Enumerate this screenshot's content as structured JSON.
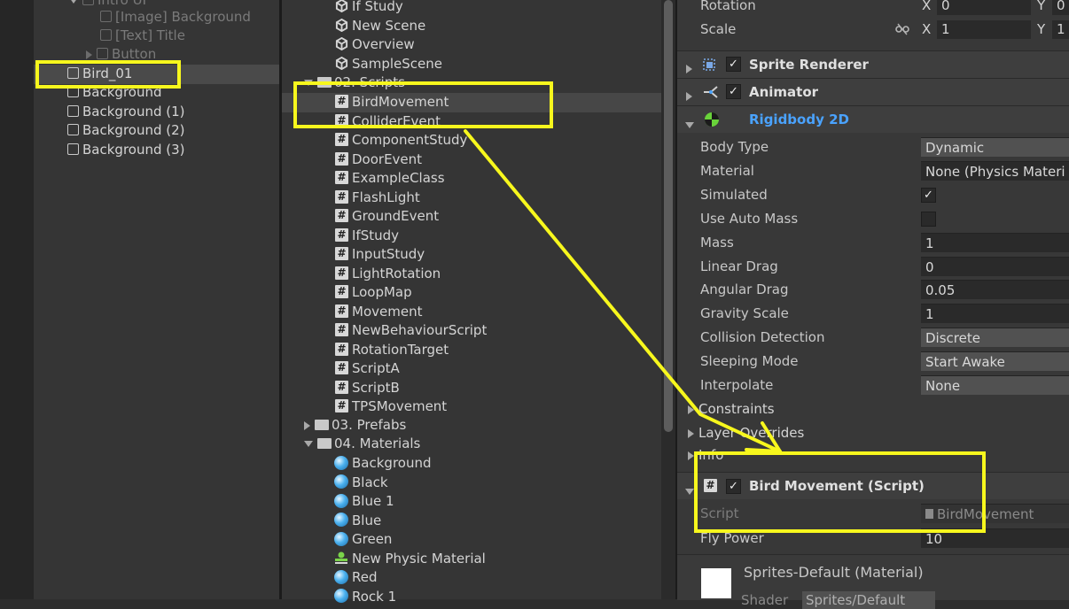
{
  "hierarchy": {
    "partial_top": "Intro UI",
    "items": [
      {
        "label": "[Image] Background",
        "dim": true
      },
      {
        "label": "[Text] Title",
        "dim": true
      },
      {
        "label": "Button",
        "dim": true
      },
      {
        "label": "Bird_01",
        "dim": false
      },
      {
        "label": "Background",
        "dim": false
      },
      {
        "label": "Background (1)",
        "dim": false
      },
      {
        "label": "Background (2)",
        "dim": false
      },
      {
        "label": "Background (3)",
        "dim": false
      }
    ]
  },
  "project": {
    "scenes": [
      "If Study",
      "New Scene",
      "Overview",
      "SampleScene"
    ],
    "scripts_folder": "02. Scripts",
    "scripts": [
      "BirdMovement",
      "ColliderEvent",
      "ComponentStudy",
      "DoorEvent",
      "ExampleClass",
      "FlashLight",
      "GroundEvent",
      "IfStudy",
      "InputStudy",
      "LightRotation",
      "LoopMap",
      "Movement",
      "NewBehaviourScript",
      "RotationTarget",
      "ScriptA",
      "ScriptB",
      "TPSMovement"
    ],
    "prefabs_folder": "03. Prefabs",
    "materials_folder": "04. Materials",
    "materials": [
      {
        "label": "Background",
        "kind": "material"
      },
      {
        "label": "Black",
        "kind": "material"
      },
      {
        "label": "Blue 1",
        "kind": "material"
      },
      {
        "label": "Blue",
        "kind": "material"
      },
      {
        "label": "Green",
        "kind": "material"
      },
      {
        "label": "New Physic Material",
        "kind": "physic"
      },
      {
        "label": "Red",
        "kind": "material"
      },
      {
        "label": "Rock 1",
        "kind": "material"
      }
    ]
  },
  "inspector": {
    "rotation": {
      "label": "Rotation",
      "x_label": "X",
      "x_value": "0",
      "y_label": "Y",
      "y_value": "0"
    },
    "scale": {
      "label": "Scale",
      "x_label": "X",
      "x_value": "1",
      "y_label": "Y",
      "y_value": "1"
    },
    "sprite_renderer": "Sprite Renderer",
    "animator": "Animator",
    "rigidbody": {
      "title": "Rigidbody 2D",
      "fields": [
        {
          "label": "Body Type",
          "value": "Dynamic",
          "type": "dropdown"
        },
        {
          "label": "Material",
          "value": "None (Physics Materi",
          "type": "object"
        },
        {
          "label": "Simulated",
          "value": "✓",
          "type": "checkbox"
        },
        {
          "label": "Use Auto Mass",
          "value": "",
          "type": "checkbox"
        },
        {
          "label": "Mass",
          "value": "1",
          "type": "number"
        },
        {
          "label": "Linear Drag",
          "value": "0",
          "type": "number"
        },
        {
          "label": "Angular Drag",
          "value": "0.05",
          "type": "number"
        },
        {
          "label": "Gravity Scale",
          "value": "1",
          "type": "number"
        },
        {
          "label": "Collision Detection",
          "value": "Discrete",
          "type": "dropdown"
        },
        {
          "label": "Sleeping Mode",
          "value": "Start Awake",
          "type": "dropdown"
        },
        {
          "label": "Interpolate",
          "value": "None",
          "type": "dropdown"
        }
      ],
      "foldouts": [
        "Constraints",
        "Layer Overrides",
        "Info"
      ]
    },
    "bird_movement": {
      "title": "Bird Movement (Script)",
      "script_label": "Script",
      "script_value": "BirdMovement",
      "fly_power_label": "Fly Power",
      "fly_power_value": "10"
    },
    "material": {
      "title": "Sprites-Default (Material)",
      "shader_label": "Shader",
      "shader_value": "Sprites/Default"
    }
  },
  "colors": {
    "highlight": "#f7f71d",
    "rigidbody_title": "#4aa3ff",
    "panel": "#353535"
  }
}
